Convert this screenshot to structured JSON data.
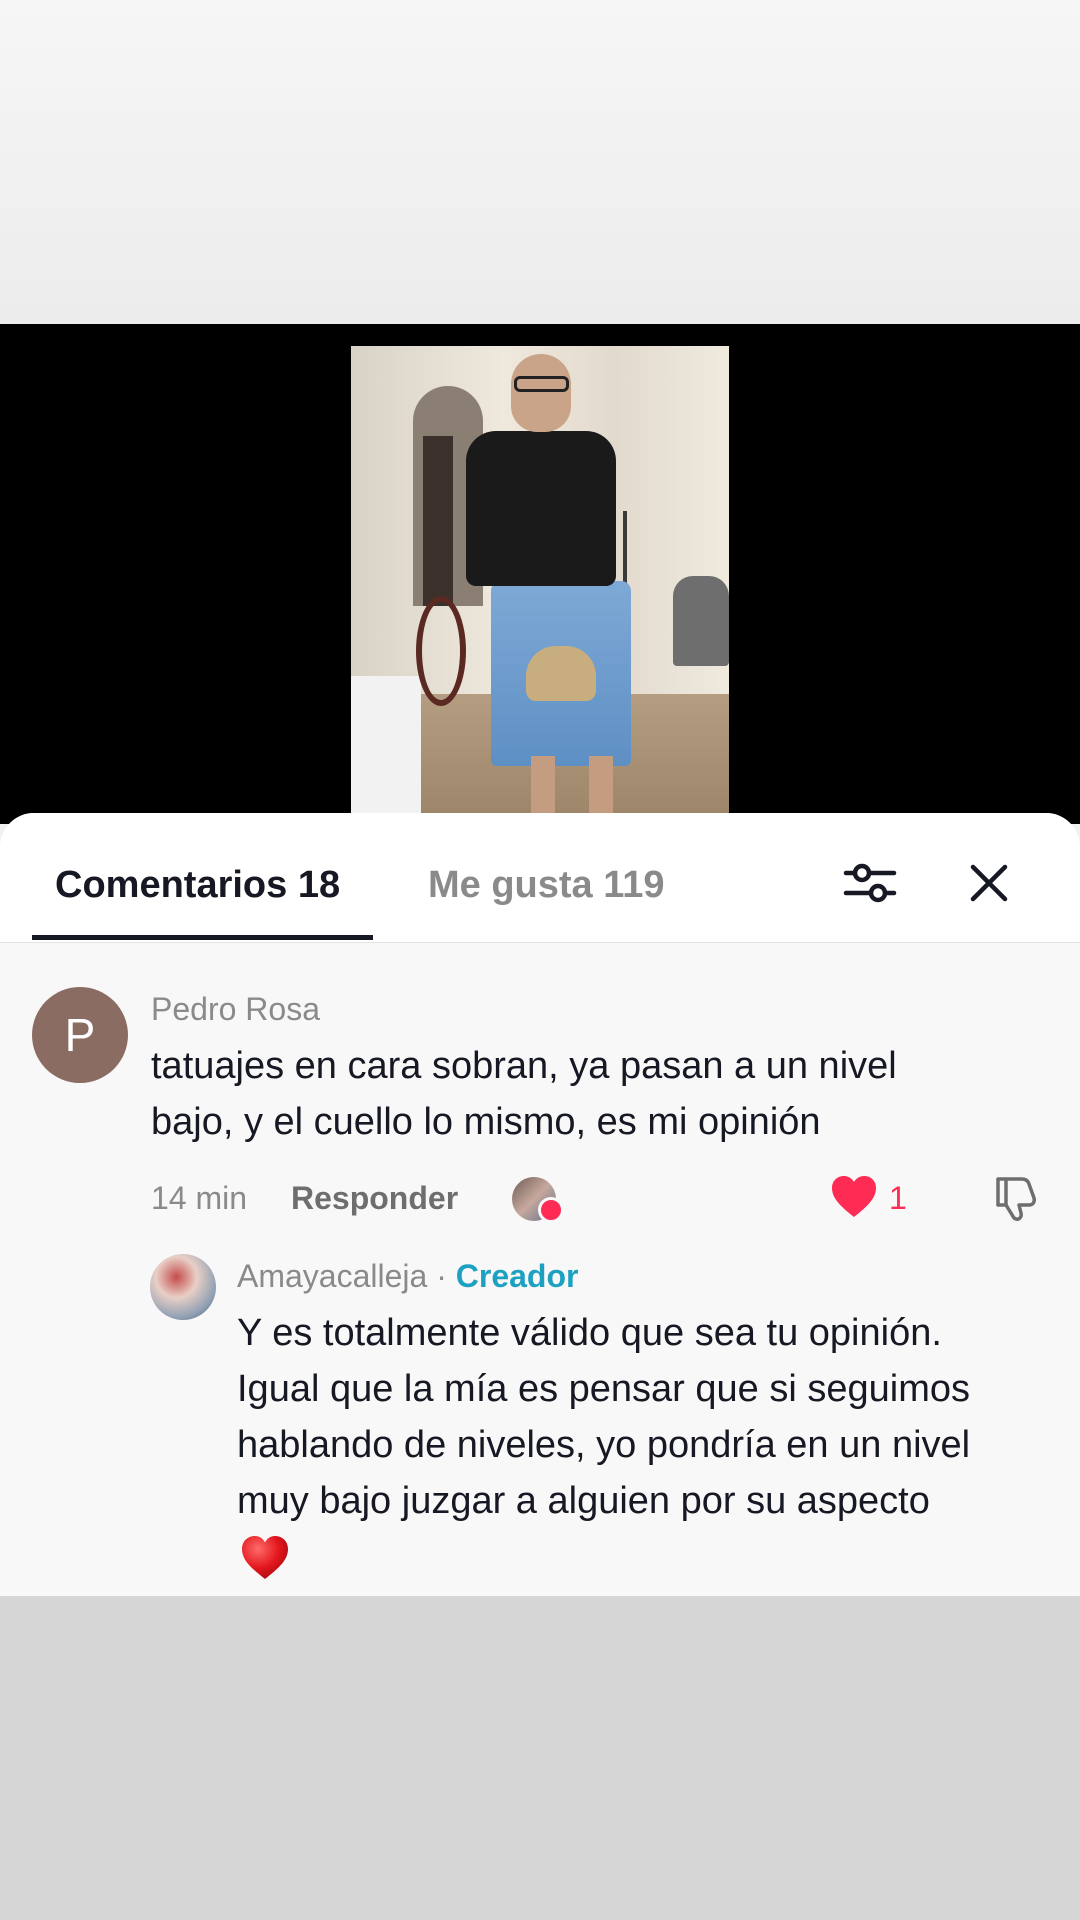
{
  "tabs": {
    "comments": "Comentarios 18",
    "likes": "Me gusta 119"
  },
  "comments": [
    {
      "avatar_initial": "P",
      "username": "Pedro Rosa",
      "text_line1": "tatuajes en cara sobran, ya pasan a un nivel",
      "text_line2": "bajo, y el cuello lo mismo, es mi opinión",
      "time": "14 min",
      "reply_label": "Responder",
      "like_count": "1"
    }
  ],
  "reply": {
    "username": "Amayacalleja",
    "separator": " · ",
    "creator_label": "Creador",
    "lines": [
      "Y es totalmente válido que sea tu opinión.",
      "Igual que la mía es pensar que si seguimos",
      "hablando de niveles, yo pondría en un nivel",
      "muy bajo juzgar a alguien por su aspecto"
    ]
  },
  "colors": {
    "accent_like": "#fe2c55",
    "creator": "#1da1c1",
    "text_primary": "#161823",
    "text_secondary": "#8a8a8a"
  },
  "icons": {
    "filter": "filter-sliders-icon",
    "close": "close-icon",
    "heart": "heart-icon",
    "dislike": "thumbs-down-icon",
    "emoji": "red-heart-emoji"
  }
}
